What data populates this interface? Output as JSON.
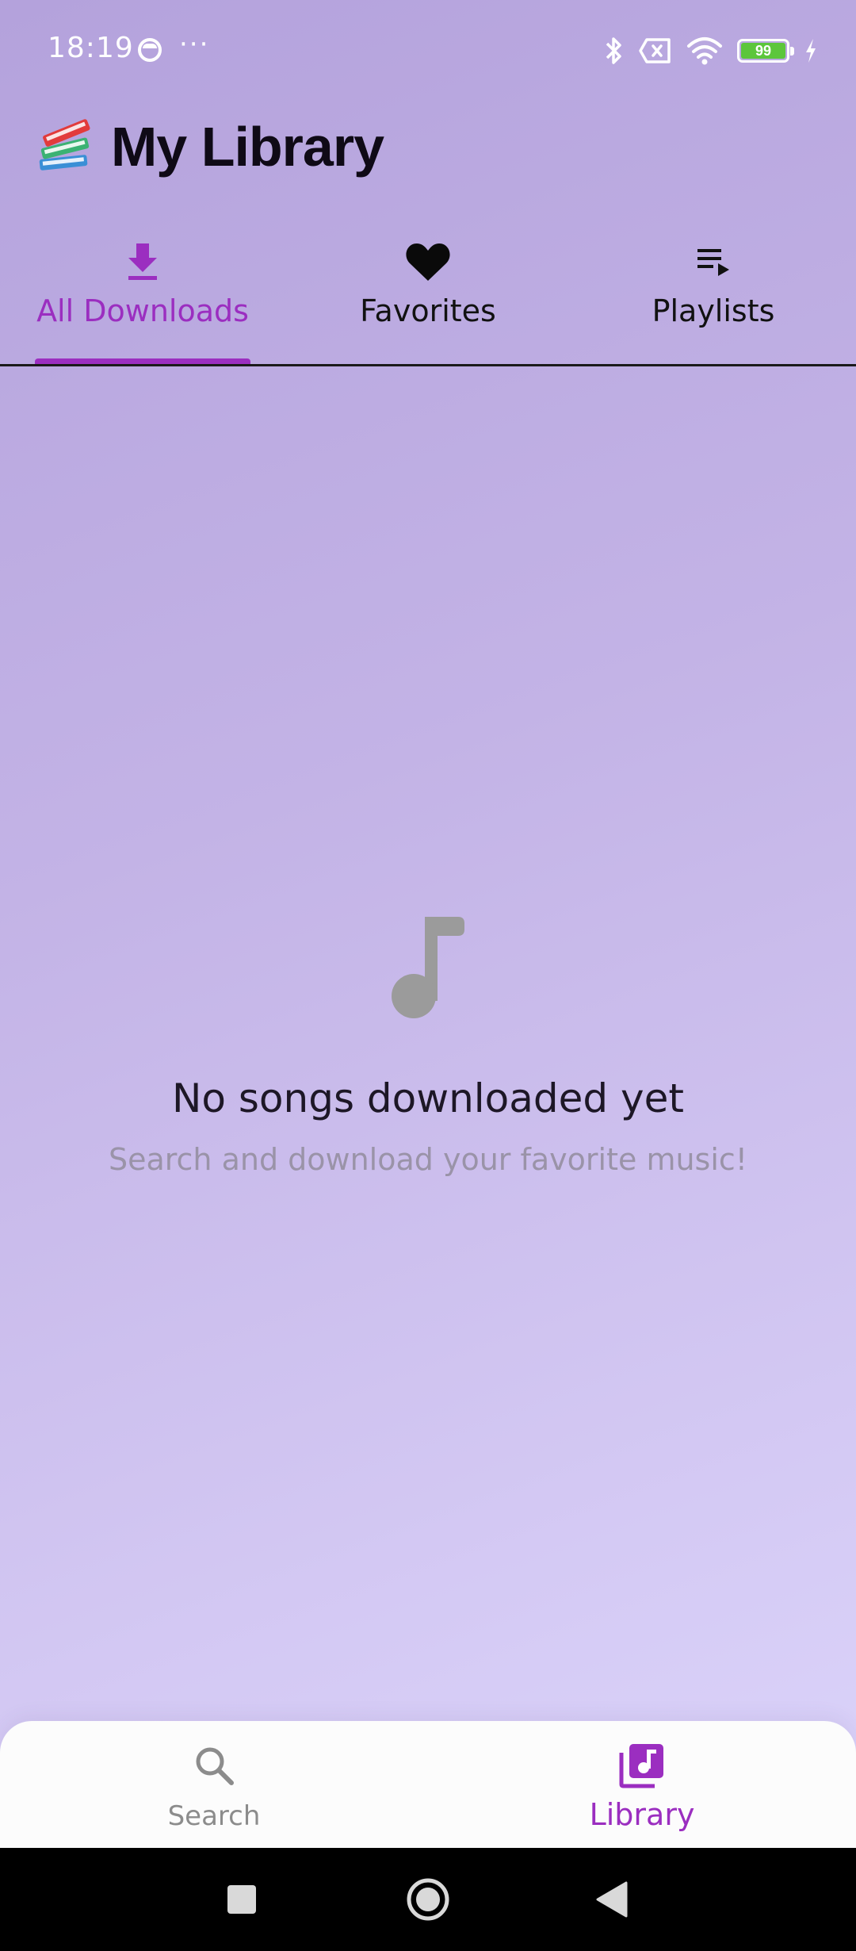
{
  "status_bar": {
    "time": "18:19",
    "dots": "···",
    "battery_level": "99",
    "icons": [
      "face-icon",
      "bluetooth-icon",
      "sim-x-icon",
      "wifi-icon",
      "battery-icon",
      "charging-icon"
    ]
  },
  "header": {
    "title": "My Library",
    "icon": "books-icon"
  },
  "tabs": [
    {
      "label": "All Downloads",
      "icon": "download-icon",
      "active": true
    },
    {
      "label": "Favorites",
      "icon": "heart-icon",
      "active": false
    },
    {
      "label": "Playlists",
      "icon": "playlist-icon",
      "active": false
    }
  ],
  "empty_state": {
    "icon": "music-note-icon",
    "title": "No songs downloaded yet",
    "subtitle": "Search and download your favorite music!"
  },
  "bottom_nav": [
    {
      "label": "Search",
      "icon": "search-icon",
      "active": false
    },
    {
      "label": "Library",
      "icon": "library-music-icon",
      "active": true
    }
  ],
  "system_nav": [
    "recents-button",
    "home-button",
    "back-button"
  ],
  "colors": {
    "accent": "#9b2ec0",
    "bg_top": "#b4a2dc",
    "bg_bottom": "#ddd6fc",
    "muted_text": "#9a93a8"
  }
}
